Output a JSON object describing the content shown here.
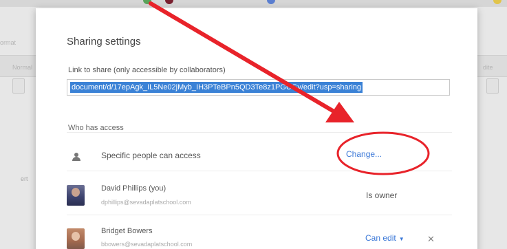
{
  "background": {
    "left_labels": [
      "ormat",
      "Normal",
      "ert"
    ],
    "right_labels": [
      "dite"
    ]
  },
  "dialog": {
    "title": "Sharing settings",
    "link_label": "Link to share (only accessible by collaborators)",
    "link_value": "document/d/17epAgk_IL5Ne02jMyb_IH3PTeBPn5QD3Te8z1PGUGv/edit?usp=sharing",
    "who_has_access": "Who has access",
    "access": {
      "icon": "person-icon",
      "text": "Specific people can access",
      "change_label": "Change..."
    },
    "people": [
      {
        "name": "David Phillips (you)",
        "email": "dphillips@sevadaplatschool.com",
        "role": "Is owner"
      },
      {
        "name": "Bridget Bowers",
        "email": "bbowers@sevadaplatschool.com",
        "role": "Can edit",
        "remove_icon": "close-icon"
      }
    ]
  },
  "colors": {
    "accent": "#3b78d8",
    "selection": "#3b82d6",
    "annotation": "#e8232a"
  }
}
